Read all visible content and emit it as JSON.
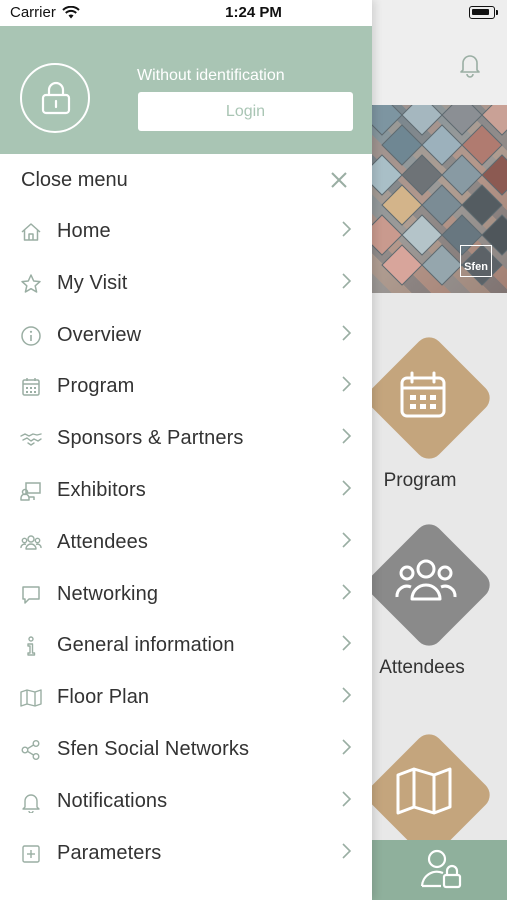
{
  "status_bar": {
    "carrier": "Carrier",
    "time": "1:24 PM"
  },
  "drawer": {
    "identification_text": "Without identification",
    "login_label": "Login",
    "close_label": "Close menu",
    "items": [
      {
        "label": "Home",
        "icon": "home-icon"
      },
      {
        "label": "My Visit",
        "icon": "star-icon"
      },
      {
        "label": "Overview",
        "icon": "info-icon"
      },
      {
        "label": "Program",
        "icon": "calendar-icon"
      },
      {
        "label": "Sponsors & Partners",
        "icon": "handshake-icon"
      },
      {
        "label": "Exhibitors",
        "icon": "exhibitor-icon"
      },
      {
        "label": "Attendees",
        "icon": "people-icon"
      },
      {
        "label": "Networking",
        "icon": "chat-icon"
      },
      {
        "label": "General information",
        "icon": "info-i-icon"
      },
      {
        "label": "Floor Plan",
        "icon": "map-icon"
      },
      {
        "label": "Sfen Social Networks",
        "icon": "share-icon"
      },
      {
        "label": "Notifications",
        "icon": "bell-icon"
      },
      {
        "label": "Parameters",
        "icon": "plus-square-icon"
      }
    ]
  },
  "background_app": {
    "badge_text": "Sfen",
    "tiles": [
      {
        "label": "Program",
        "icon": "calendar-icon",
        "color": "#c4a57d"
      },
      {
        "label": "Attendees",
        "icon": "people-icon",
        "color": "#8a8a8a"
      },
      {
        "label": "",
        "icon": "map-icon",
        "color": "#c4a57d"
      }
    ]
  },
  "colors": {
    "accent": "#a9c5b4",
    "bottom_bar": "#8fb09c",
    "text": "#333333",
    "icon": "#9aaea3"
  }
}
